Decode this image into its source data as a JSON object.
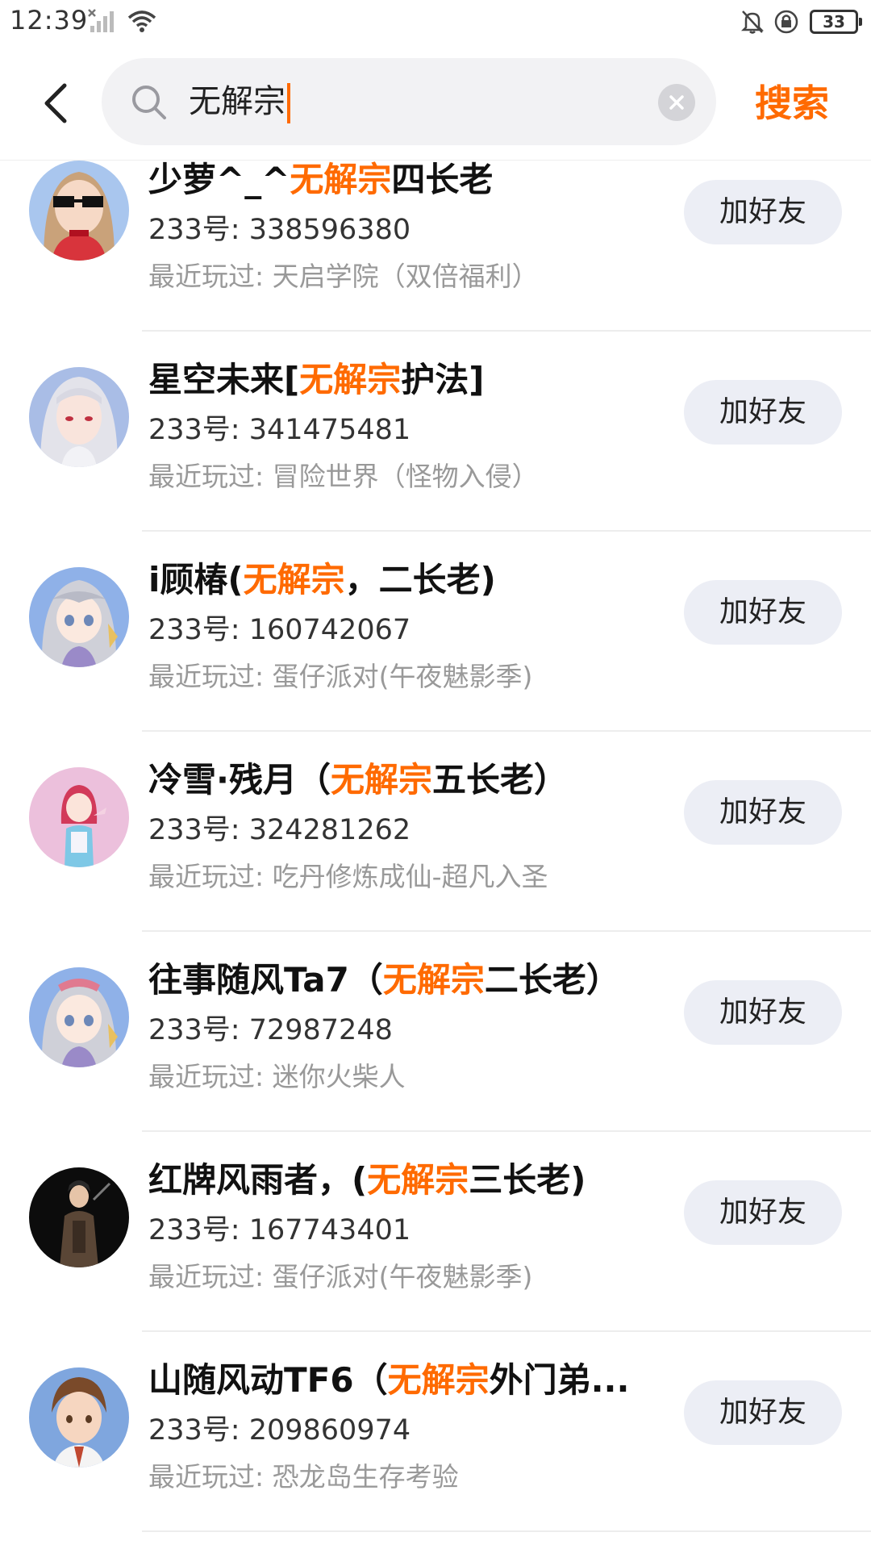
{
  "status_bar": {
    "time": "12:39",
    "battery": "33"
  },
  "search": {
    "query": "无解宗",
    "button_label": "搜索"
  },
  "colors": {
    "accent": "#ff6a00",
    "button_bg": "#eceef5"
  },
  "results": [
    {
      "name_pre": "少萝^_^",
      "name_hl": "无解宗",
      "name_post": "四长老",
      "uid": "233号: 338596380",
      "recent": "最近玩过: 天启学院（双倍福利）",
      "add_label": "加好友",
      "avatar_bg": "#c0485a"
    },
    {
      "name_pre": "星空未来[",
      "name_hl": "无解宗",
      "name_post": "护法]",
      "uid": "233号: 341475481",
      "recent": "最近玩过: 冒险世界（怪物入侵）",
      "add_label": "加好友",
      "avatar_bg": "#a9bde6"
    },
    {
      "name_pre": "i顾椿(",
      "name_hl": "无解宗",
      "name_post": "，二长老)",
      "uid": "233号: 160742067",
      "recent": "最近玩过: 蛋仔派对(午夜魅影季)",
      "add_label": "加好友",
      "avatar_bg": "#8fb1e8"
    },
    {
      "name_pre": "冷雪·残月（",
      "name_hl": "无解宗",
      "name_post": "五长老）",
      "uid": "233号: 324281262",
      "recent": "最近玩过: 吃丹修炼成仙-超凡入圣",
      "add_label": "加好友",
      "avatar_bg": "#e9b3d6"
    },
    {
      "name_pre": "往事随风Ta7（",
      "name_hl": "无解宗",
      "name_post": "二长老）",
      "uid": "233号: 72987248",
      "recent": "最近玩过: 迷你火柴人",
      "add_label": "加好友",
      "avatar_bg": "#8fb1e8"
    },
    {
      "name_pre": "红牌风雨者，(",
      "name_hl": "无解宗",
      "name_post": "三长老)",
      "uid": "233号: 167743401",
      "recent": "最近玩过: 蛋仔派对(午夜魅影季)",
      "add_label": "加好友",
      "avatar_bg": "#111111"
    },
    {
      "name_pre": "山随风动TF6（",
      "name_hl": "无解宗",
      "name_post": "外门弟...",
      "uid": "233号: 209860974",
      "recent": "最近玩过: 恐龙岛生存考验",
      "add_label": "加好友",
      "avatar_bg": "#7fa6de"
    }
  ]
}
